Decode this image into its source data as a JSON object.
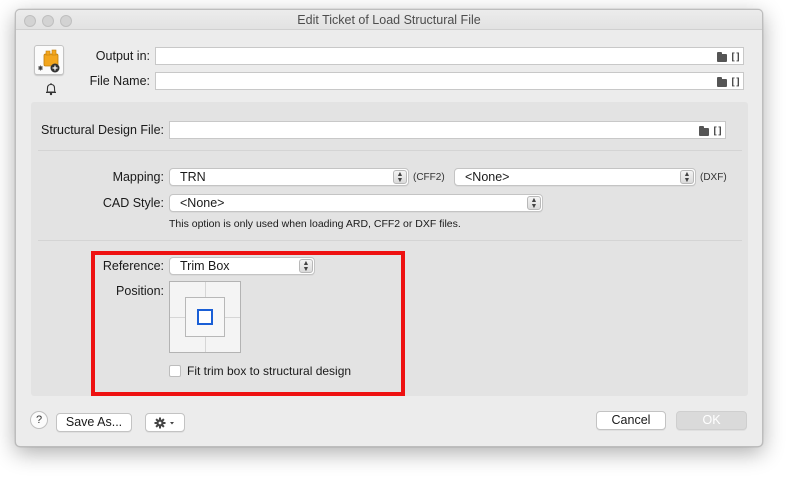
{
  "window": {
    "title": "Edit Ticket of Load Structural File"
  },
  "header": {
    "output_in_label": "Output in:",
    "output_in_value": "",
    "file_name_label": "File Name:",
    "file_name_value": ""
  },
  "structural": {
    "label": "Structural Design File:",
    "value": ""
  },
  "mapping": {
    "label": "Mapping:",
    "cff2_value": "TRN",
    "cff2_suffix": "(CFF2)",
    "dxf_value": "<None>",
    "dxf_suffix": "(DXF)"
  },
  "cad_style": {
    "label": "CAD Style:",
    "value": "<None>",
    "note": "This option is only used when loading ARD, CFF2 or DXF files."
  },
  "reference": {
    "label": "Reference:",
    "value": "Trim Box"
  },
  "position": {
    "label": "Position:"
  },
  "fit_checkbox": {
    "label": "Fit trim box to structural design",
    "checked": false
  },
  "footer": {
    "help_label": "?",
    "save_as_label": "Save As...",
    "cancel_label": "Cancel",
    "ok_label": "OK"
  },
  "colors": {
    "highlight": "#ee1111",
    "position_marker": "#1a5fd6",
    "window_bg": "#ececec",
    "panel_bg": "#e3e3e3"
  }
}
